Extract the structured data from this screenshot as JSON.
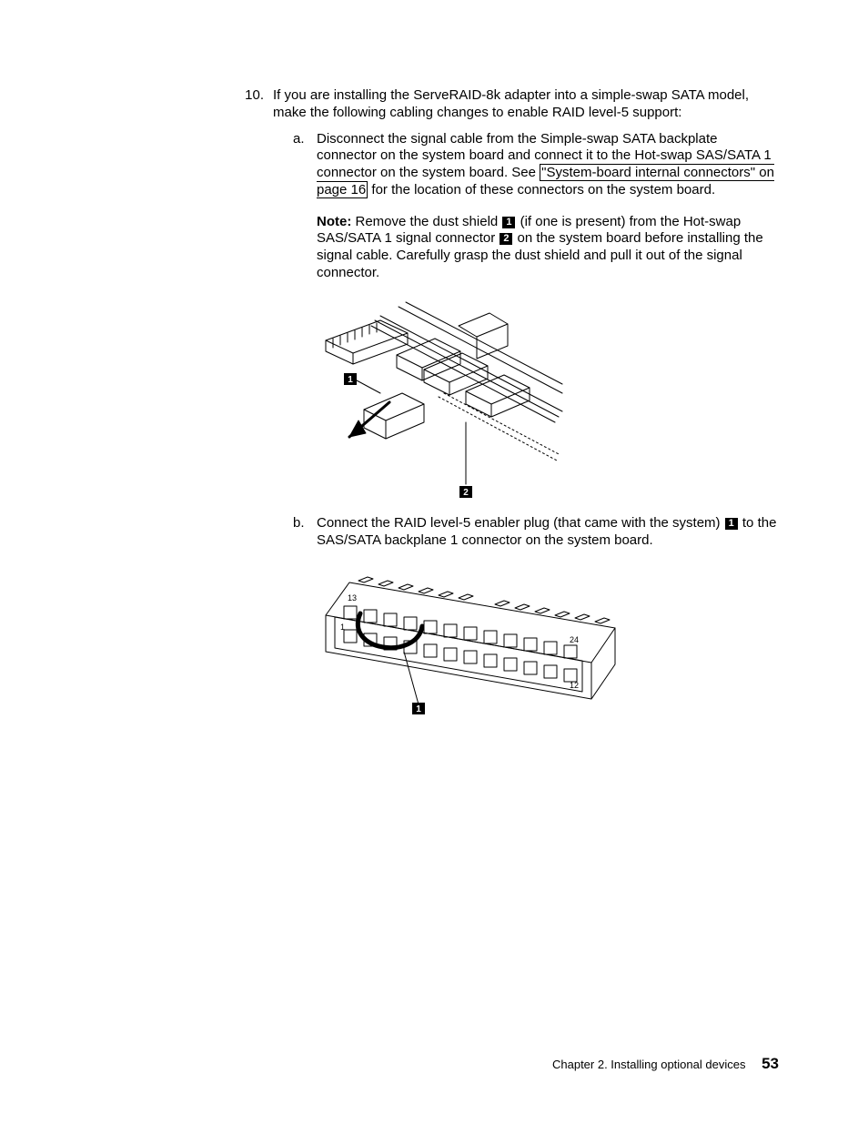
{
  "step": {
    "number": "10.",
    "intro": "If you are installing the ServeRAID-8k adapter into a simple-swap SATA model, make the following cabling changes to enable RAID level-5 support:",
    "a_letter": "a.",
    "a_part1": "Disconnect the signal cable from the Simple-swap SATA backplate connector on the system board and connect it to the Hot-swap SAS/SATA 1 connector on the system board. See ",
    "a_link": "\"System-board internal connectors\" on page 16",
    "a_part2": " for the location of these connectors on the system board.",
    "note_label": "Note:",
    "note_seg1": "Remove the dust shield ",
    "note_co1": "1",
    "note_seg2": " (if one is present) from the Hot-swap SAS/SATA 1 signal connector ",
    "note_co2": "2",
    "note_seg3": " on the system board before installing the signal cable. Carefully grasp the dust shield and pull it out of the signal connector.",
    "b_letter": "b.",
    "b_seg1": "Connect the RAID level-5 enabler plug (that came with the system) ",
    "b_co1": "1",
    "b_seg2": " to the SAS/SATA backplane 1 connector on the system board."
  },
  "fig1": {
    "callout1": "1",
    "callout2": "2"
  },
  "fig2": {
    "callout1": "1",
    "pin13": "13",
    "pin1": "1",
    "pin24": "24",
    "pin12": "12"
  },
  "footer": {
    "chapter": "Chapter 2. Installing optional devices",
    "page": "53"
  }
}
